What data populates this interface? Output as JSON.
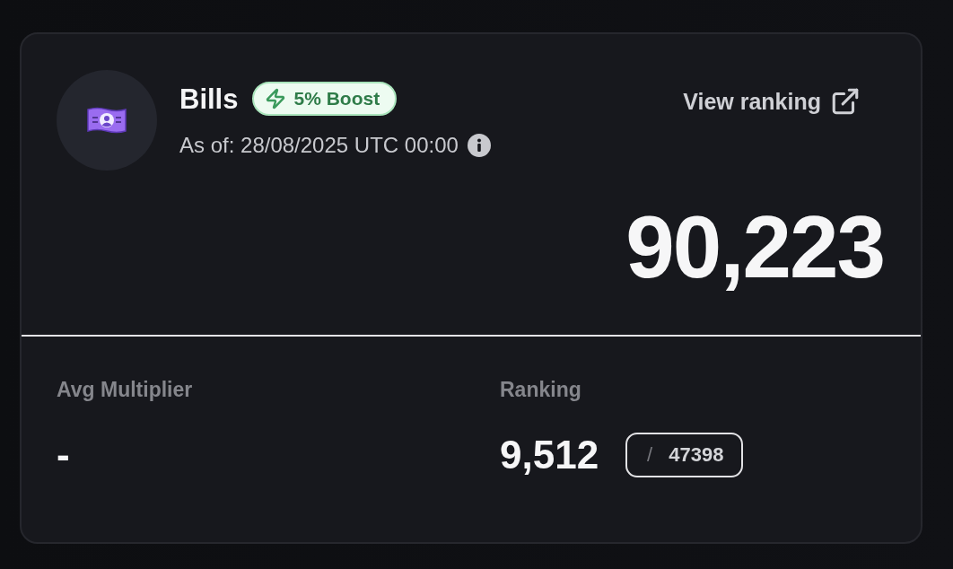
{
  "stat_card": {
    "title": "Bills",
    "boost_badge": {
      "label": "5% Boost"
    },
    "as_of": "As of: 28/08/2025 UTC 00:00",
    "view_ranking_link": "View ranking",
    "total": "90,223",
    "avg_multiplier": {
      "label": "Avg Multiplier",
      "value": "-"
    },
    "ranking": {
      "label": "Ranking",
      "value": "9,512",
      "separator": "/",
      "out_of": "47398"
    }
  }
}
